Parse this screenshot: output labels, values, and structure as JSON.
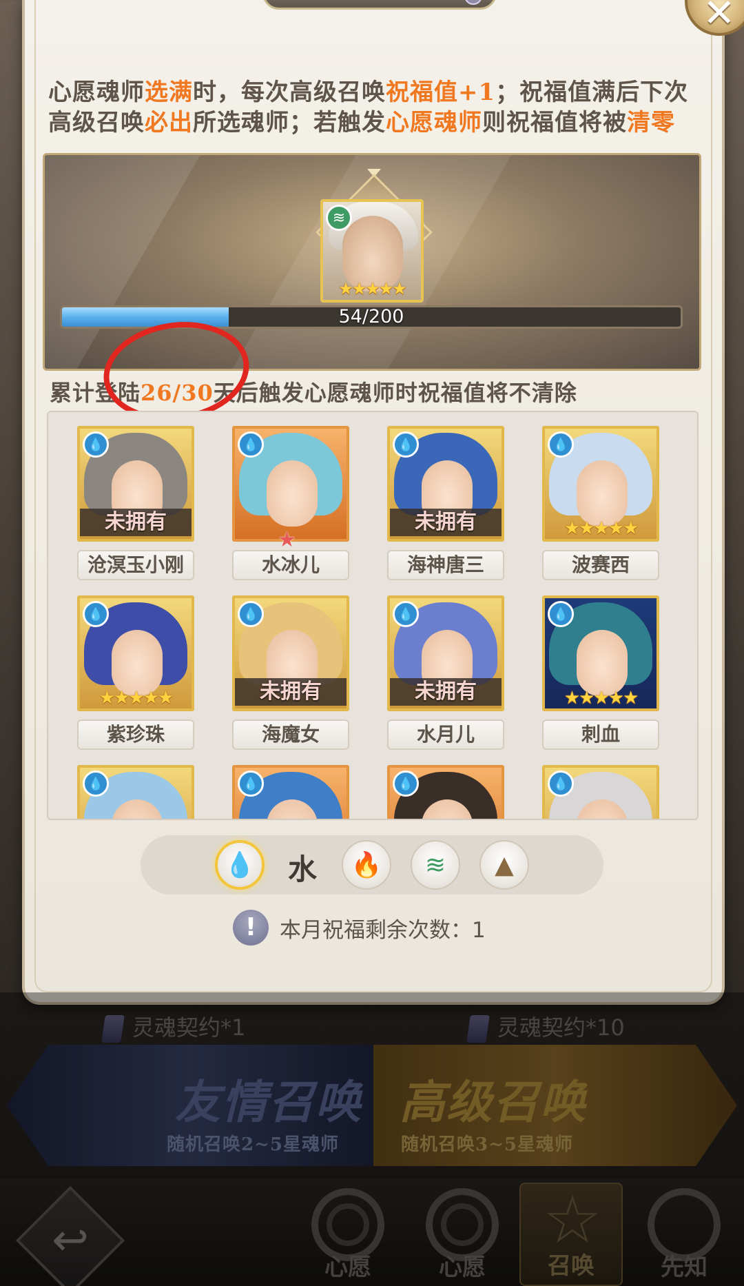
{
  "description": {
    "part1": "心愿魂师",
    "hl1": "选满",
    "part2": "时，每次高级召唤",
    "hl2": "祝福值+1",
    "part3": "；祝福值满后下次高级召唤",
    "hl3": "必出",
    "part4": "所选魂师；若触发",
    "hl4": "心愿魂师",
    "part5": "则祝福值将被",
    "hl5": "清零"
  },
  "featured": {
    "element_icon": "wind-icon",
    "stars": "★★★★★",
    "progress_text": "54/200",
    "progress_value": 54,
    "progress_max": 200
  },
  "login_note": {
    "prefix": "累计登陆",
    "days": "26/30",
    "suffix": "天后触发心愿魂师时祝福值将不清除"
  },
  "characters": [
    {
      "name": "沧溟玉小刚",
      "status": "未拥有",
      "stars": "",
      "frame": "gold",
      "hair": "#8c8680"
    },
    {
      "name": "水冰儿",
      "status": "",
      "stars": "",
      "frame": "orange",
      "hair": "#7cc7d8",
      "mark": "★"
    },
    {
      "name": "海神唐三",
      "status": "未拥有",
      "stars": "",
      "frame": "gold",
      "hair": "#3b67b8"
    },
    {
      "name": "波赛西",
      "status": "",
      "stars": "★★★★★",
      "frame": "gold",
      "hair": "#c9dcef"
    },
    {
      "name": "紫珍珠",
      "status": "",
      "stars": "★★★★★",
      "frame": "gold",
      "hair": "#3d4da8"
    },
    {
      "name": "海魔女",
      "status": "未拥有",
      "stars": "",
      "frame": "gold",
      "hair": "#e6c27a"
    },
    {
      "name": "水月儿",
      "status": "未拥有",
      "stars": "",
      "frame": "gold",
      "hair": "#6c7fcf"
    },
    {
      "name": "刺血",
      "status": "",
      "stars": "★★★★★",
      "frame": "blue",
      "hair": "#2f7f8e"
    },
    {
      "name": "",
      "status": "",
      "stars": "",
      "frame": "gold",
      "hair": "#9cc8e8"
    },
    {
      "name": "",
      "status": "",
      "stars": "",
      "frame": "orange",
      "hair": "#3f7fc8"
    },
    {
      "name": "",
      "status": "",
      "stars": "",
      "frame": "orange",
      "hair": "#3a2e28"
    },
    {
      "name": "",
      "status": "",
      "stars": "",
      "frame": "gold",
      "hair": "#d8d6d6"
    }
  ],
  "filter": {
    "selected_label": "水",
    "elements": [
      "water-icon",
      "fire-icon",
      "wind-icon",
      "earth-icon"
    ]
  },
  "remaining": {
    "icon": "!",
    "text": "本月祝福剩余次数：1"
  },
  "contracts": {
    "left": "灵魂契约*1",
    "right": "灵魂契约*10"
  },
  "summons": {
    "friend_title": "友情召唤",
    "friend_sub": "随机召唤2~5星魂师",
    "advanced_title": "高级召唤",
    "advanced_sub": "随机召唤3~5星魂师"
  },
  "nav": {
    "items": [
      "心愿",
      "心愿",
      "召唤",
      "先知"
    ]
  },
  "colors": {
    "highlight": "#f07820",
    "unowned_overlay": "#342c28",
    "progress_blue": "#5ab0ec",
    "annotation_red": "#e0261e"
  }
}
